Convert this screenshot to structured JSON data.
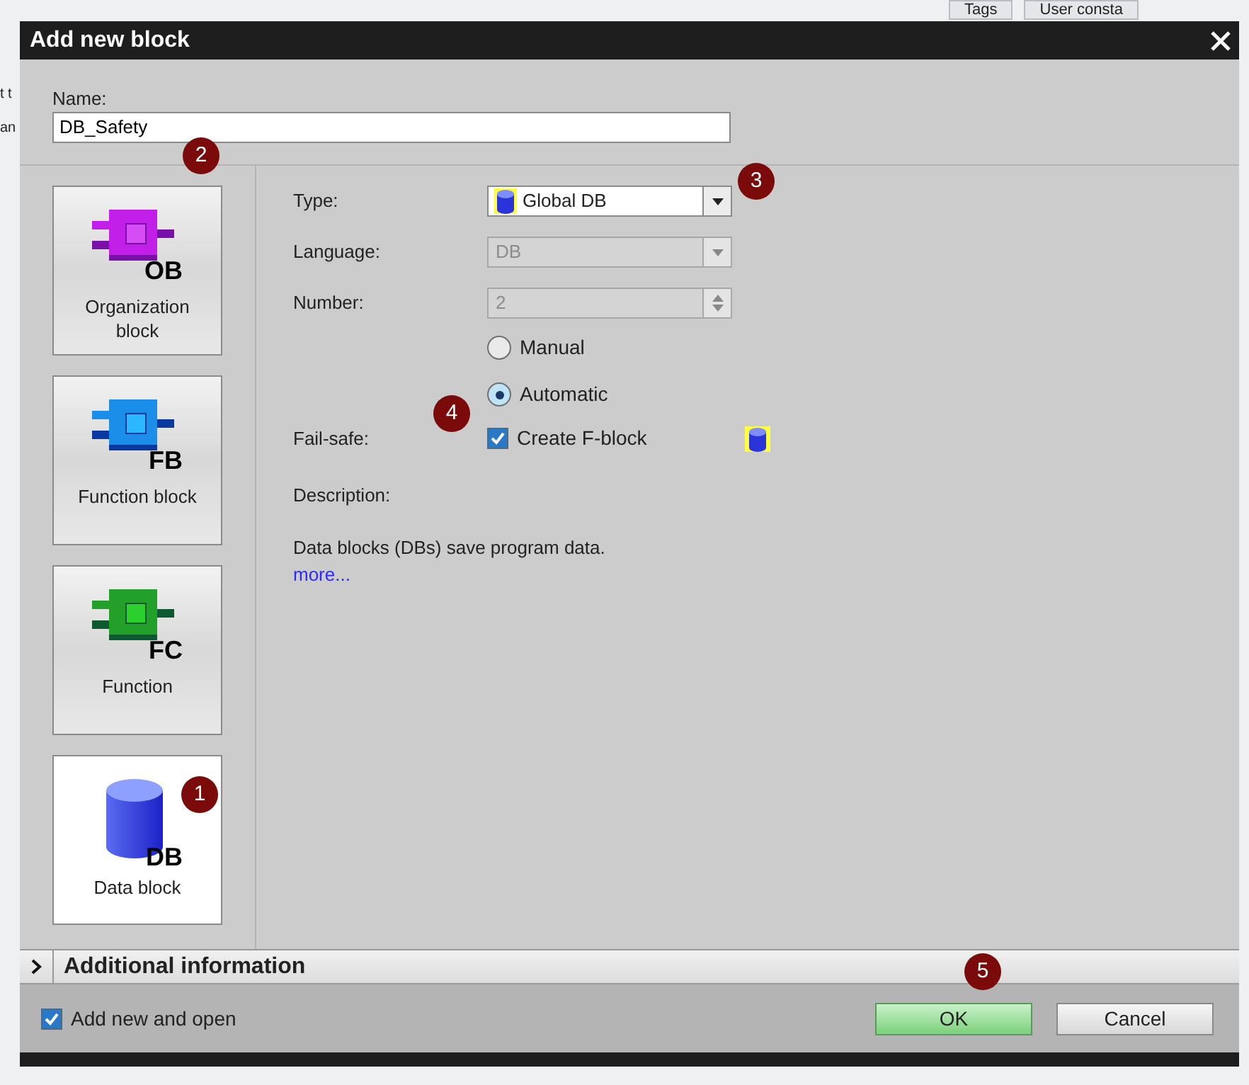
{
  "background": {
    "tabs": [
      "Tags",
      "User consta"
    ],
    "fragments": [
      "t t",
      "an"
    ]
  },
  "window": {
    "title": "Add new block"
  },
  "name": {
    "label": "Name:",
    "value": "DB_Safety"
  },
  "blocks": [
    {
      "kind": "ob",
      "code": "OB",
      "label": "Organization block",
      "selected": false
    },
    {
      "kind": "fb",
      "code": "FB",
      "label": "Function block",
      "selected": false
    },
    {
      "kind": "fc",
      "code": "FC",
      "label": "Function",
      "selected": false
    },
    {
      "kind": "db",
      "code": "DB",
      "label": "Data block",
      "selected": true
    }
  ],
  "type": {
    "label": "Type:",
    "value": "Global DB"
  },
  "language": {
    "label": "Language:",
    "value": "DB",
    "disabled": true
  },
  "number": {
    "label": "Number:",
    "value": "2",
    "disabled": true
  },
  "numbering": [
    {
      "label": "Manual",
      "selected": false
    },
    {
      "label": "Automatic",
      "selected": true
    }
  ],
  "failsafe": {
    "label": "Fail-safe:",
    "option": "Create F-block",
    "checked": true
  },
  "description": {
    "label": "Description:",
    "text": "Data blocks (DBs) save program data.",
    "link": "more..."
  },
  "additional_information": {
    "label": "Additional information",
    "expanded": false
  },
  "footer": {
    "add_and_open": {
      "label": "Add new and open",
      "checked": true
    },
    "buttons": [
      {
        "kind": "primary",
        "label": "OK"
      },
      {
        "kind": "secondary",
        "label": "Cancel"
      }
    ]
  },
  "markers": [
    "1",
    "2",
    "3",
    "4",
    "5"
  ]
}
